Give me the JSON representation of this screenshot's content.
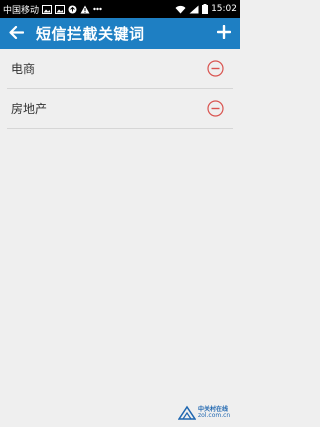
{
  "status_bar": {
    "carrier": "中国移动",
    "time": "15:02",
    "icons": [
      "image-icon",
      "image-icon",
      "sync-icon",
      "warning-icon",
      "more-dots-icon",
      "wifi-icon",
      "signal-icon",
      "battery-icon"
    ]
  },
  "app_bar": {
    "title": "短信拦截关键词",
    "back_icon": "arrow-left-icon",
    "add_icon": "plus-icon"
  },
  "keywords": [
    {
      "label": "电商"
    },
    {
      "label": "房地产"
    }
  ],
  "watermark": {
    "line1": "中关村在线",
    "line2": "zol.com.cn"
  },
  "colors": {
    "app_bar": "#1e7fc3",
    "background": "#efefef",
    "remove_icon": "#d9534f"
  }
}
